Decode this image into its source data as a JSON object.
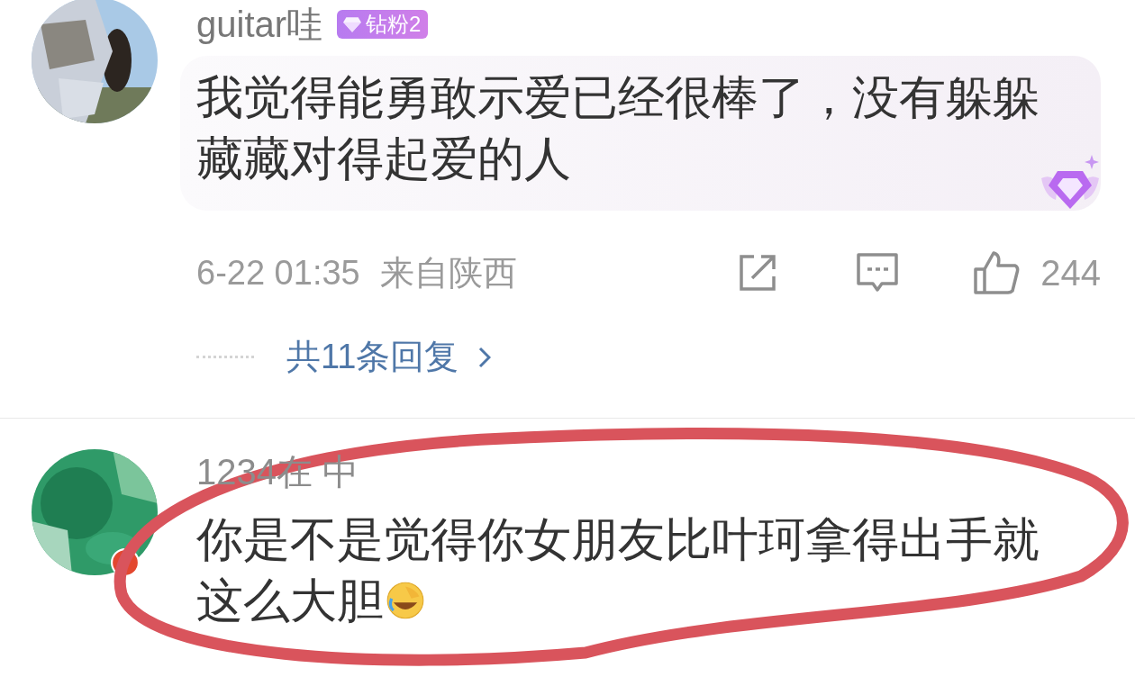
{
  "comments": [
    {
      "username": "guitar哇",
      "fan_badge": "钻粉2",
      "text": "我觉得能勇敢示爱已经很棒了，没有躲躲藏藏对得起爱的人",
      "fan_bubble": true,
      "time": "6-22 01:35",
      "location": "来自陕西",
      "likes": "244",
      "replies_link": "共11条回复"
    },
    {
      "username": "1234在 中",
      "text": "你是不是觉得你女朋友比叶珂拿得出手就这么大胆",
      "emoji": true,
      "circled": true
    }
  ]
}
